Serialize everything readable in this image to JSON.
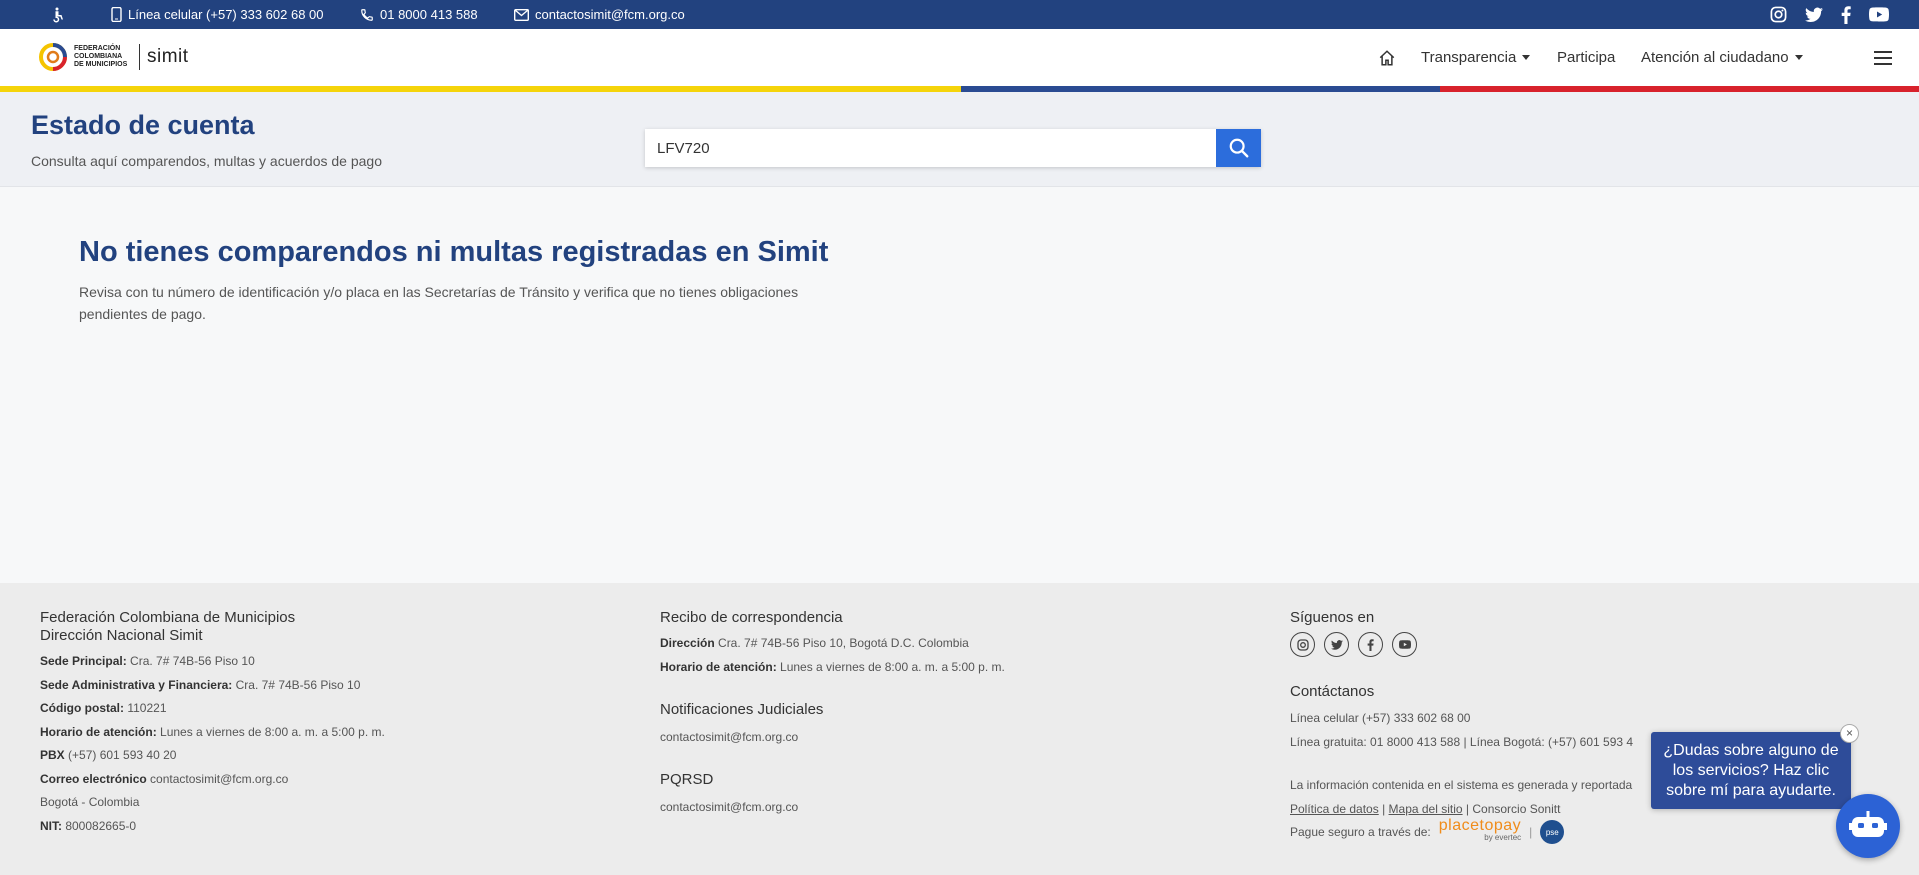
{
  "topbar": {
    "phone_label": "Línea celular (+57) 333 602 68 00",
    "toll_free_label": "01 8000 413 588",
    "email_label": "contactosimit@fcm.org.co",
    "social": [
      "instagram-icon",
      "twitter-icon",
      "facebook-icon",
      "youtube-icon"
    ]
  },
  "header": {
    "logo_text": "FEDERACIÓN COLOMBIANA DE MUNICIPIOS",
    "logo_simit": "simit",
    "nav": {
      "transparencia": "Transparencia",
      "participa": "Participa",
      "atencion": "Atención al ciudadano"
    }
  },
  "hero": {
    "title": "Estado de cuenta",
    "subtitle": "Consulta aquí comparendos, multas y acuerdos de pago",
    "search_value": "LFV720"
  },
  "main": {
    "title": "No tienes comparendos ni multas registradas en Simit",
    "text": "Revisa con tu número de identificación y/o placa en las Secretarías de Tránsito y verifica que no tienes obligaciones pendientes de pago."
  },
  "footer": {
    "col1": {
      "title1": "Federación Colombiana de Municipios",
      "title2": "Dirección Nacional Simit",
      "rows": [
        {
          "label": "Sede Principal:",
          "value": " Cra. 7# 74B-56 Piso 10"
        },
        {
          "label": "Sede Administrativa y Financiera:",
          "value": " Cra. 7# 74B-56 Piso 10"
        },
        {
          "label": "Código postal:",
          "value": " 110221"
        },
        {
          "label": "Horario de atención:",
          "value": " Lunes a viernes de 8:00 a. m. a 5:00 p. m."
        },
        {
          "label": "PBX",
          "value": " (+57) 601 593 40 20"
        },
        {
          "label": "Correo electrónico",
          "value": " contactosimit@fcm.org.co"
        },
        {
          "label": "",
          "value": "Bogotá - Colombia"
        },
        {
          "label": "NIT:",
          "value": " 800082665-0"
        }
      ]
    },
    "col2": {
      "title": "Recibo de correspondencia",
      "direccion_label": "Dirección",
      "direccion_value": " Cra. 7# 74B-56 Piso 10, Bogotá D.C. Colombia",
      "horario_label": "Horario de atención:",
      "horario_value": " Lunes a viernes de 8:00 a. m. a 5:00 p. m.",
      "notif_title": "Notificaciones Judiciales",
      "notif_email": "contactosimit@fcm.org.co",
      "pqrsd_title": "PQRSD",
      "pqrsd_email": "contactosimit@fcm.org.co"
    },
    "col3": {
      "follow_title": "Síguenos en",
      "contact_title": "Contáctanos",
      "line1": "Línea celular (+57) 333 602 68 00",
      "line2": "Línea gratuita: 01 8000 413 588 | Línea Bogotá: (+57) 601 593 4",
      "info": "La información contenida en el sistema es generada y reportada",
      "link_politica": "Política de datos",
      "sep": " | ",
      "link_mapa": "Mapa del sitio",
      "consorcio": " | Consorcio Sonitt",
      "pague": "Pague seguro a través de:",
      "placetopay": "placetopay",
      "evertec": "by evertec",
      "pse": "pse"
    }
  },
  "chat": {
    "bubble_text": "¿Dudas sobre alguno de los servicios? Haz clic sobre mí para ayudarte.",
    "close": "×"
  }
}
